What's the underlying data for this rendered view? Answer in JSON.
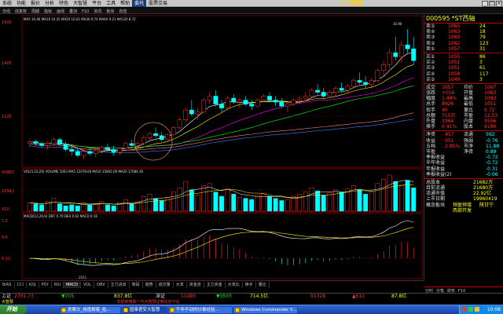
{
  "menubar": {
    "items": [
      "系统",
      "功能",
      "报价",
      "分析",
      "特色",
      "大智慧",
      "平台",
      "工具",
      "帮助",
      "委托",
      "股票交易"
    ],
    "active_index": 9,
    "logo": "大智慧"
  },
  "toolbar2": {
    "items": [
      "日线",
      "前复权",
      "周期",
      "指标",
      "画线",
      "叠加",
      "F10",
      "资讯",
      "板块",
      "自选"
    ]
  },
  "stock": {
    "code": "000595",
    "name": "*ST西轴"
  },
  "chart_labels": {
    "price_high": "1600",
    "price_mid": "1405",
    "price_low": "1125",
    "vol_top": "43883",
    "vol_mid": "21942",
    "vol_unit": "X10",
    "macd_1": "1.5",
    "macd_2": "0.6",
    "macd_3": "0.12",
    "ma_legend": "MA5 10.46  MA10 10.25  MA20 10.01  MA30 9.74  MA60 9.21  MA120 8.72",
    "vol_legend": "VOL(5,10,20)  VOLUME 1063  MA5 12078.60  MA10 15892.00  MA20 17084.30",
    "macd_legend": "MACD(12,26,9)  DIFF 0.70  DEA 0.62  MACD 0.16",
    "top_price_tag": "10.90",
    "time_label": "2011"
  },
  "chart_data": {
    "type": "candlestick",
    "candles": [
      [
        8.9,
        9.0,
        8.8,
        8.95
      ],
      [
        8.95,
        9.0,
        8.85,
        8.9
      ],
      [
        8.9,
        8.95,
        8.8,
        8.85
      ],
      [
        8.85,
        8.95,
        8.75,
        8.9
      ],
      [
        8.9,
        9.05,
        8.85,
        9.0
      ],
      [
        9.0,
        9.05,
        8.85,
        8.88
      ],
      [
        8.88,
        8.95,
        8.7,
        8.75
      ],
      [
        8.75,
        8.85,
        8.6,
        8.7
      ],
      [
        8.7,
        8.8,
        8.55,
        8.6
      ],
      [
        8.6,
        8.75,
        8.5,
        8.7
      ],
      [
        8.7,
        8.8,
        8.6,
        8.65
      ],
      [
        8.65,
        8.75,
        8.55,
        8.72
      ],
      [
        8.72,
        8.85,
        8.65,
        8.8
      ],
      [
        8.8,
        8.9,
        8.7,
        8.75
      ],
      [
        8.75,
        8.85,
        8.6,
        8.68
      ],
      [
        8.68,
        8.8,
        8.6,
        8.78
      ],
      [
        8.78,
        8.95,
        8.7,
        8.9
      ],
      [
        8.9,
        9.0,
        8.8,
        8.85
      ],
      [
        8.85,
        8.95,
        8.75,
        8.9
      ],
      [
        8.9,
        9.1,
        8.85,
        9.05
      ],
      [
        9.05,
        9.2,
        9.0,
        9.15
      ],
      [
        9.15,
        9.3,
        9.05,
        9.1
      ],
      [
        9.1,
        9.2,
        8.95,
        9.0
      ],
      [
        9.0,
        9.15,
        8.95,
        9.12
      ],
      [
        9.12,
        9.35,
        9.1,
        9.3
      ],
      [
        9.3,
        9.55,
        9.25,
        9.5
      ],
      [
        9.5,
        9.8,
        9.45,
        9.75
      ],
      [
        9.75,
        10.0,
        9.6,
        9.65
      ],
      [
        9.65,
        9.8,
        9.5,
        9.7
      ],
      [
        9.7,
        10.05,
        9.65,
        10.0
      ],
      [
        10.0,
        10.2,
        9.9,
        10.1
      ],
      [
        10.1,
        10.25,
        9.85,
        9.9
      ],
      [
        9.9,
        10.0,
        9.7,
        9.8
      ],
      [
        9.8,
        10.1,
        9.75,
        10.05
      ],
      [
        10.05,
        10.15,
        9.9,
        9.95
      ],
      [
        9.95,
        10.05,
        9.8,
        10.0
      ],
      [
        10.0,
        10.1,
        9.85,
        9.9
      ],
      [
        9.9,
        10.0,
        9.75,
        9.85
      ],
      [
        9.85,
        10.05,
        9.8,
        10.0
      ],
      [
        10.0,
        10.15,
        9.95,
        10.1
      ],
      [
        10.1,
        10.2,
        9.95,
        10.0
      ],
      [
        10.0,
        10.1,
        9.85,
        9.95
      ],
      [
        9.95,
        10.05,
        9.8,
        9.85
      ],
      [
        9.85,
        9.95,
        9.7,
        9.9
      ],
      [
        9.9,
        10.05,
        9.85,
        10.0
      ],
      [
        10.0,
        10.1,
        9.9,
        10.05
      ],
      [
        10.05,
        10.2,
        10.0,
        10.1
      ],
      [
        10.1,
        10.3,
        10.05,
        10.25
      ],
      [
        10.25,
        10.4,
        10.15,
        10.2
      ],
      [
        10.2,
        10.3,
        10.05,
        10.1
      ],
      [
        10.1,
        10.25,
        10.05,
        10.2
      ],
      [
        10.2,
        10.35,
        10.1,
        10.3
      ],
      [
        10.3,
        10.45,
        10.2,
        10.25
      ],
      [
        10.25,
        10.4,
        10.15,
        10.35
      ],
      [
        10.35,
        10.55,
        10.3,
        10.5
      ],
      [
        10.5,
        10.7,
        10.4,
        10.45
      ],
      [
        10.45,
        10.6,
        10.3,
        10.4
      ],
      [
        10.4,
        10.55,
        10.3,
        10.5
      ],
      [
        10.5,
        10.8,
        10.45,
        10.75
      ],
      [
        10.75,
        11.0,
        10.6,
        10.9
      ],
      [
        10.9,
        11.3,
        10.8,
        11.2
      ],
      [
        11.2,
        11.6,
        11.0,
        11.1
      ],
      [
        11.1,
        11.5,
        10.95,
        11.4
      ],
      [
        11.4,
        11.8,
        11.2,
        11.3
      ],
      [
        11.3,
        11.6,
        10.9,
        11.0
      ]
    ],
    "volumes": [
      8,
      7,
      6,
      9,
      12,
      7,
      5,
      6,
      5,
      8,
      6,
      7,
      9,
      6,
      5,
      8,
      11,
      7,
      9,
      14,
      16,
      12,
      10,
      13,
      18,
      22,
      28,
      20,
      15,
      24,
      26,
      18,
      14,
      21,
      16,
      13,
      12,
      11,
      15,
      17,
      14,
      12,
      10,
      11,
      14,
      16,
      18,
      22,
      19,
      15,
      17,
      20,
      18,
      21,
      24,
      20,
      16,
      18,
      26,
      30,
      34,
      28,
      25,
      29,
      22
    ],
    "ylim": [
      8.4,
      11.9
    ]
  },
  "quote": {
    "sell": [
      {
        "label": "卖⑤",
        "price": "1065",
        "vol": "24"
      },
      {
        "label": "卖④",
        "price": "1063",
        "vol": "18"
      },
      {
        "label": "卖③",
        "price": "1060",
        "vol": "79"
      },
      {
        "label": "卖②",
        "price": "1062",
        "vol": "123"
      },
      {
        "label": "卖①",
        "price": "1057",
        "vol": "31"
      }
    ],
    "buy": [
      {
        "label": "买①",
        "price": "1055",
        "vol": "86"
      },
      {
        "label": "买②",
        "price": "1051",
        "vol": "3"
      },
      {
        "label": "买③",
        "price": "1051",
        "vol": "61"
      },
      {
        "label": "买④",
        "price": "1050",
        "vol": "117"
      },
      {
        "label": "买⑤",
        "price": "1040",
        "vol": "3"
      }
    ],
    "stats": [
      {
        "k1": "成交",
        "v1": "1057",
        "k2": "均价",
        "v2": "1067"
      },
      {
        "k1": "涨跌",
        "v1": "+016",
        "k2": "开盘",
        "v2": "1063"
      },
      {
        "k1": "幅度",
        "v1": "1.49%",
        "k2": "最高",
        "v2": "1093"
      },
      {
        "k1": "总手",
        "v1": "8926",
        "k2": "最低",
        "v2": "1051"
      },
      {
        "k1": "现手",
        "v1": "40",
        "k2": "量比",
        "v2": "0.72"
      },
      {
        "k1": "总额",
        "v1": "715万",
        "k2": "市盈",
        "v2": "12.53"
      },
      {
        "k1": "外盘",
        "v1": "3364",
        "k2": "内盘",
        "v2": "5556"
      },
      {
        "k1": "换手",
        "v1": "0.41%",
        "k2": "股本",
        "v2": "9190"
      }
    ],
    "fin": [
      {
        "k1": "净资",
        "v1": "457",
        "k2": "流通",
        "v2": "592"
      },
      {
        "k1": "收益",
        "v1": "951",
        "k2": "强弱",
        "v2": "-0.76"
      },
      {
        "k1": "五档",
        "v1": "2.85%",
        "k2": "市净",
        "v2": "11.88"
      },
      {
        "k1": "市盈",
        "v1": "",
        "k2": "净资",
        "v2": "0.89"
      },
      {
        "k1": "季报收益",
        "v1": "",
        "k2": "",
        "v2": "-0.72"
      },
      {
        "k1": "半年收益",
        "v1": "",
        "k2": "",
        "v2": "-0.72"
      },
      {
        "k1": "年报收益",
        "v1": "",
        "k2": "",
        "v2": "-0.31"
      },
      {
        "k1": "季报收益(2)",
        "v1": "",
        "k2": "",
        "v2": "-0.06"
      }
    ],
    "info": [
      {
        "k": "总股本",
        "v": "21682万"
      },
      {
        "k": "目前流通",
        "v": "21680万"
      },
      {
        "k": "流通市值",
        "v": "22.92亿"
      },
      {
        "k": "上市日期",
        "v": "19960419"
      }
    ],
    "sector_label": "概念板块",
    "sector_1": "预盈预增",
    "sector_2": "陕甘宁",
    "sector_3": "西部开发"
  },
  "bottom_tabs": [
    "BIAS",
    "CCI",
    "KDJ",
    "PSY",
    "RSI",
    "MACD",
    "VOL",
    "OBV",
    "主力进出",
    "筹码",
    "趋势",
    "成交量",
    "大单",
    "资金流",
    "主力资金",
    "大单比",
    "换手",
    "量比"
  ],
  "right_tabs": [
    "分时",
    "分笔",
    "财务",
    "F10"
  ],
  "statusbar": {
    "idx1_name": "上证",
    "idx1_val": "2701.73",
    "idx1_chg": "▼705",
    "idx1_amt": "837.8亿",
    "idx2_name": "深证",
    "idx2_val": "11493",
    "idx2_chg": "▼3503",
    "idx2_amt": "714.5亿",
    "idx3_val": "91328",
    "idx3_chg": "▲612",
    "idx3_amt": "87.8亿"
  },
  "ticker": {
    "left": "大智慧",
    "text": "欢迎使用新一代大智慧证券信息平台"
  },
  "taskbar": {
    "start": "开始",
    "items": [
      "发票文_用度解套_贴...",
      "国泰君安大智慧",
      "千年不动的炒事经验...",
      "Windows Commander 5..."
    ],
    "clock": "10:08"
  }
}
